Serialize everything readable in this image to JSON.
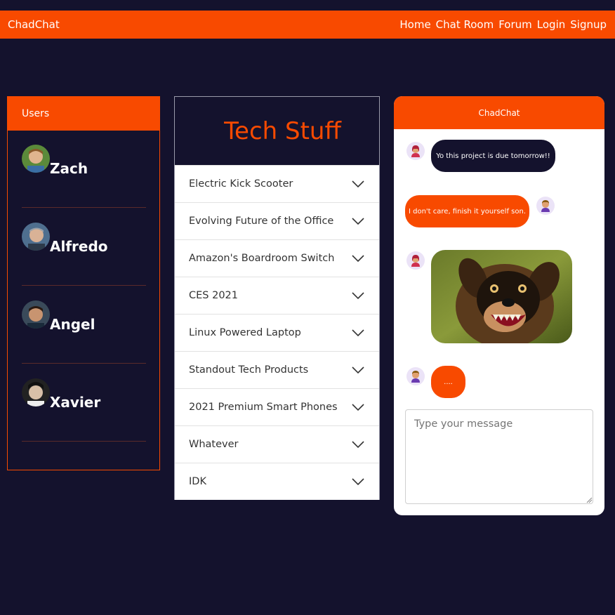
{
  "navbar": {
    "brand": "ChadChat",
    "links": [
      "Home",
      "Chat Room",
      "Forum",
      "Login",
      "Signup"
    ]
  },
  "users": {
    "header": "Users",
    "list": [
      "Zach",
      "Alfredo",
      "Angel",
      "Xavier"
    ]
  },
  "topics": {
    "title": "Tech Stuff",
    "items": [
      "Electric Kick Scooter",
      "Evolving Future of the Office",
      "Amazon's Boardroom Switch",
      "CES 2021",
      "Linux Powered Laptop",
      "Standout Tech Products",
      "2021 Premium Smart Phones",
      "Whatever",
      "IDK"
    ]
  },
  "chat": {
    "header": "ChadChat",
    "messages": [
      {
        "text": "Yo this project is due tomorrow!!"
      },
      {
        "text": "I don't care, finish it yourself son."
      },
      {
        "text": "...."
      }
    ],
    "input_placeholder": "Type your message"
  },
  "colors": {
    "accent": "#f84a00",
    "background": "#14122d"
  }
}
